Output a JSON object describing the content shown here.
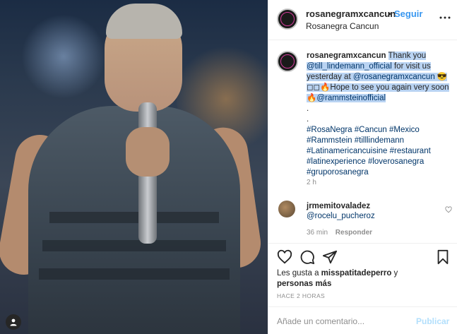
{
  "header": {
    "username": "rosanegramxcancun",
    "dot": "•",
    "follow_label": "Seguir",
    "location": "Rosanegra Cancun",
    "more_icon": "more-horizontal-icon"
  },
  "caption": {
    "username": "rosanegramxcancun",
    "text_parts": {
      "t1": "Thank you",
      "mention1": "@till_lindemann_official",
      "t2": " for visit us yesterday at ",
      "mention2": "@rosanegramxcancun",
      "t3": " 😎 ◻◻🔥Hope to see you again very soon 🔥",
      "mention3": "@rammsteinofficial",
      "dot1": ".",
      "dot2": ".",
      "tags1": "#RosaNegra #Cancun #Mexico",
      "tags2": "#Rammstein #tilllindemann",
      "tags3": "#Latinamericancuisine #restaurant",
      "tags4": "#latinexperience #loverosanegra",
      "tags5": "#gruporosanegra"
    },
    "time": "2 h"
  },
  "comment": {
    "username": "jrmemitovaladez",
    "mention": "@rocelu_pucheroz",
    "time": "36 min",
    "reply_label": "Responder"
  },
  "likes": {
    "prefix": "Les gusta a ",
    "user": "misspatitadeperro",
    "suffix": " y",
    "others": "personas más"
  },
  "posted": "HACE 2 HORAS",
  "add_comment": {
    "placeholder": "Añade un comentario...",
    "post_label": "Publicar"
  },
  "colors": {
    "link": "#003569",
    "follow": "#3897f0",
    "highlight": "#b9d3f2",
    "publish_disabled": "#b2dffc"
  }
}
